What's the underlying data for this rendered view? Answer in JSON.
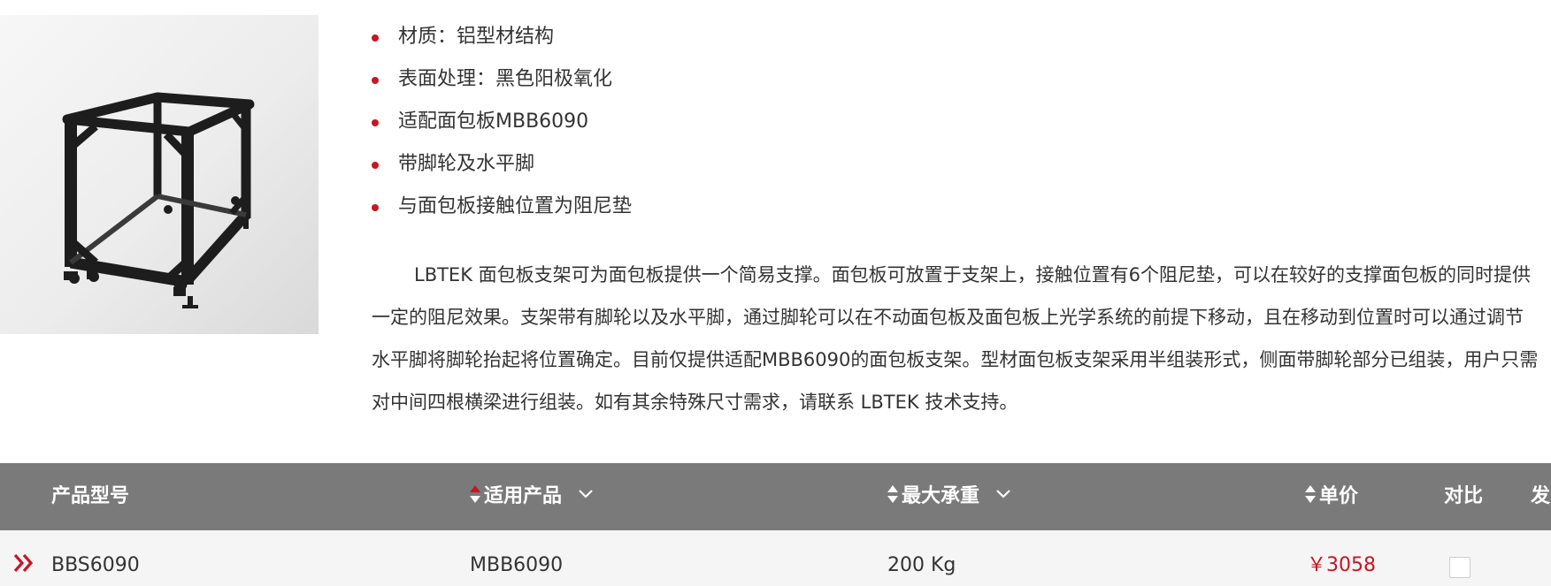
{
  "product": {
    "image_alt": "面包板支架",
    "features": [
      "材质：铝型材结构",
      "表面处理：黑色阳极氧化",
      "适配面包板MBB6090",
      "带脚轮及水平脚",
      "与面包板接触位置为阻尼垫"
    ],
    "description": "LBTEK 面包板支架可为面包板提供一个简易支撑。面包板可放置于支架上，接触位置有6个阻尼垫，可以在较好的支撑面包板的同时提供一定的阻尼效果。支架带有脚轮以及水平脚，通过脚轮可以在不动面包板及面包板上光学系统的前提下移动，且在移动到位置时可以通过调节水平脚将脚轮抬起将位置确定。目前仅提供适配MBB6090的面包板支架。型材面包板支架采用半组装形式，侧面带脚轮部分已组装，用户只需对中间四根横梁进行组装。如有其余特殊尺寸需求，请联系 LBTEK 技术支持。"
  },
  "table": {
    "headers": {
      "model": "产品型号",
      "applicable": "适用产品",
      "max_load": "最大承重",
      "price": "单价",
      "compare": "对比",
      "ship": "发"
    },
    "rows": [
      {
        "model": "BBS6090",
        "applicable": "MBB6090",
        "max_load": "200 Kg",
        "price": "￥3058",
        "compare_checked": false
      }
    ]
  },
  "colors": {
    "accent": "#c81623",
    "header_bg": "#7a7a7a",
    "row_bg": "#f5f5f5"
  },
  "icons": {
    "expand": "double-chevron-right-icon",
    "sort": "sort-arrows-icon",
    "filter": "chevron-down-icon"
  }
}
